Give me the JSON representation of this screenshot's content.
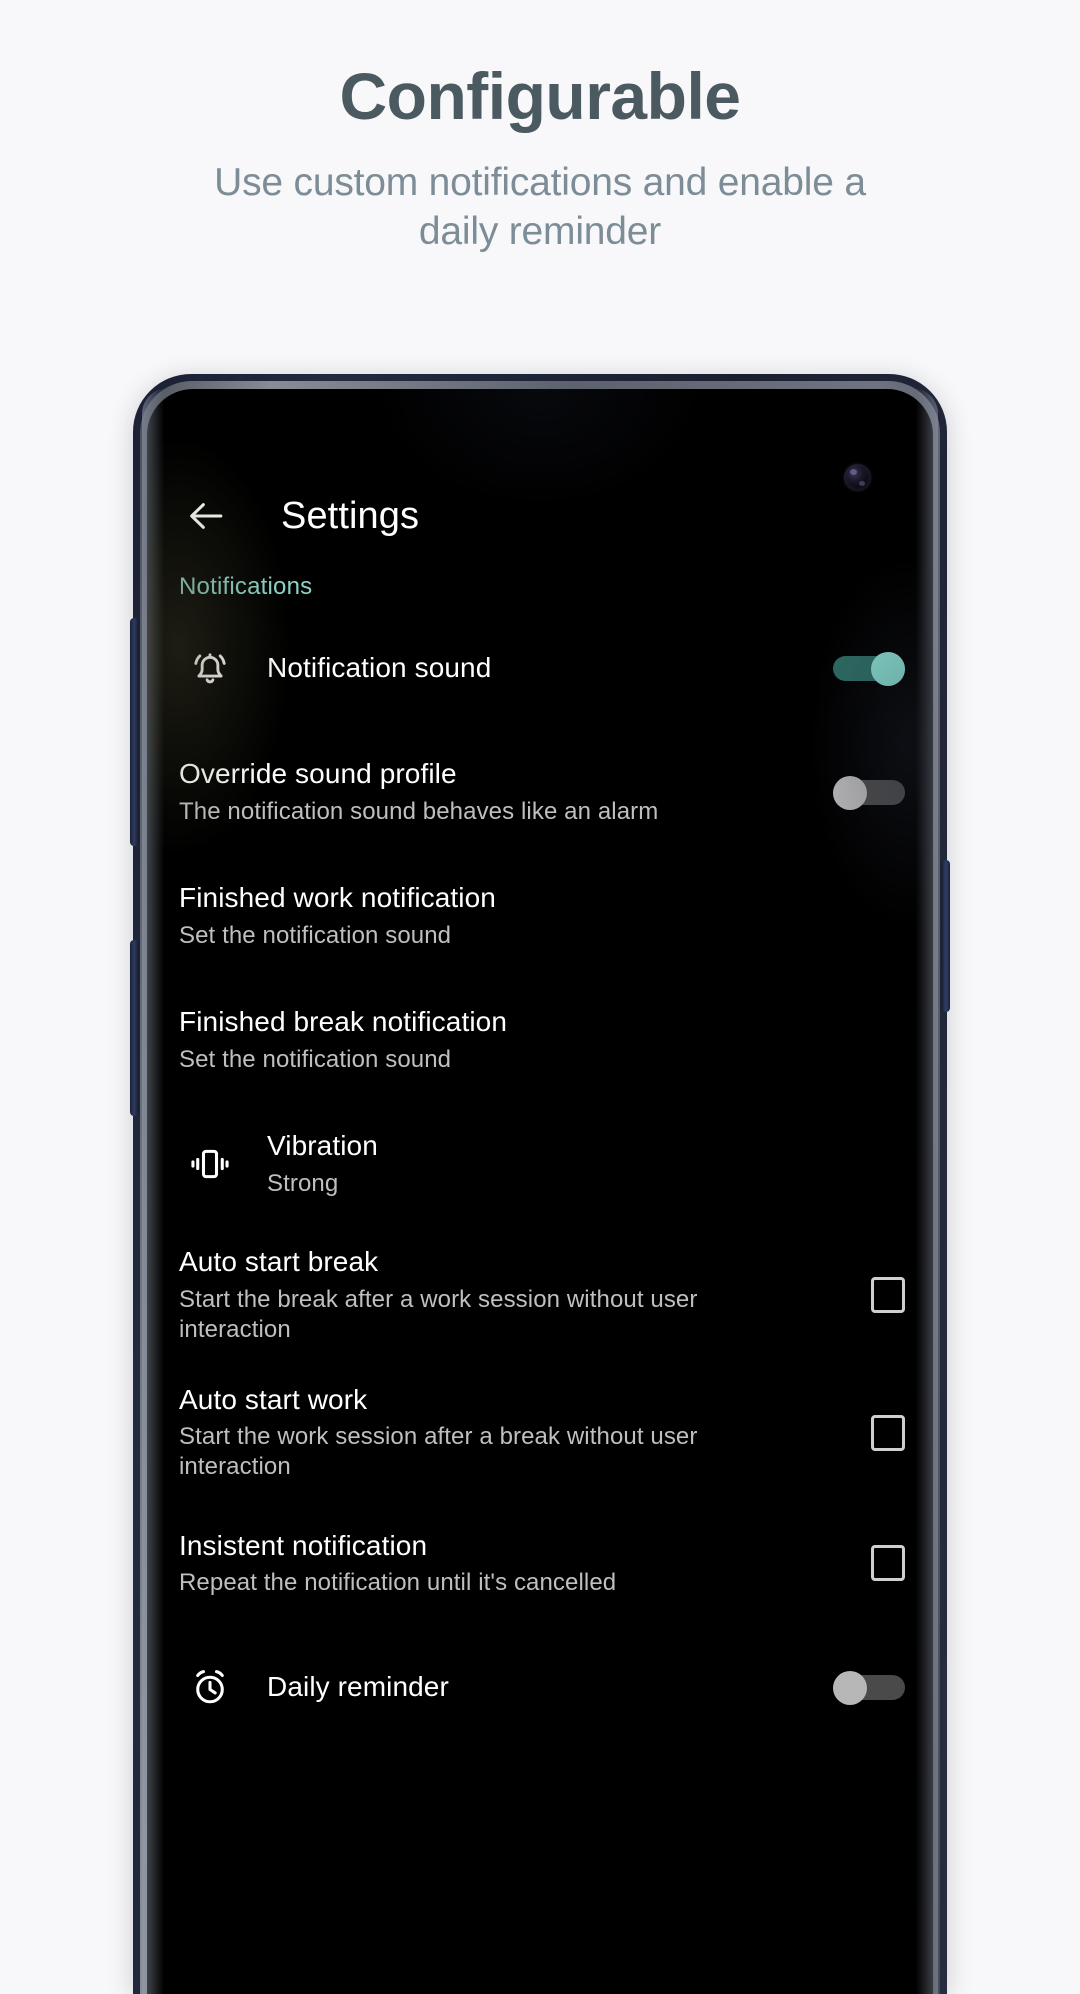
{
  "promo": {
    "title": "Configurable",
    "subtitle": "Use custom notifications and enable a daily reminder"
  },
  "colors": {
    "page_background": "#f8f8fa",
    "promo_title": "#4b5960",
    "promo_subtitle": "#7d8d97",
    "screen_background": "#000000",
    "section_label": "#8fd3c8",
    "toggle_on_thumb": "#86dace",
    "toggle_on_track": "#2d6a62",
    "toggle_off_thumb": "#b7b7b7",
    "toggle_off_track": "#4a4a4a",
    "checkbox_border": "#cfcfcf",
    "bezel": "#1b2034",
    "rim": "#878c97"
  },
  "app": {
    "back_icon": "arrow-back-icon",
    "title": "Settings",
    "section": "Notifications",
    "rows": [
      {
        "id": "notification-sound",
        "icon": "bell-ring-icon",
        "title": "Notification sound",
        "sub": "",
        "control": "toggle",
        "state": "on"
      },
      {
        "id": "override-sound-profile",
        "icon": "",
        "title": "Override sound profile",
        "sub": "The notification sound behaves like an alarm",
        "control": "toggle",
        "state": "off"
      },
      {
        "id": "finished-work-notification",
        "icon": "",
        "title": "Finished work notification",
        "sub": "Set the notification sound",
        "control": "none",
        "state": ""
      },
      {
        "id": "finished-break-notification",
        "icon": "",
        "title": "Finished break notification",
        "sub": "Set the notification sound",
        "control": "none",
        "state": ""
      },
      {
        "id": "vibration",
        "icon": "vibration-icon",
        "title": "Vibration",
        "sub": "Strong",
        "control": "none",
        "state": ""
      },
      {
        "id": "auto-start-break",
        "icon": "",
        "title": "Auto start break",
        "sub": "Start the break after a work session without user interaction",
        "control": "checkbox",
        "state": "unchecked"
      },
      {
        "id": "auto-start-work",
        "icon": "",
        "title": "Auto start work",
        "sub": "Start the work session after a break without user interaction",
        "control": "checkbox",
        "state": "unchecked"
      },
      {
        "id": "insistent-notification",
        "icon": "",
        "title": "Insistent notification",
        "sub": "Repeat the notification until it's cancelled",
        "control": "checkbox",
        "state": "unchecked"
      },
      {
        "id": "daily-reminder",
        "icon": "alarm-clock-icon",
        "title": "Daily reminder",
        "sub": "",
        "control": "toggle",
        "state": "off"
      }
    ]
  },
  "device": {
    "buttons": [
      "volume-up-button",
      "volume-down-button",
      "power-button"
    ],
    "camera": "front-camera-punch-hole"
  }
}
